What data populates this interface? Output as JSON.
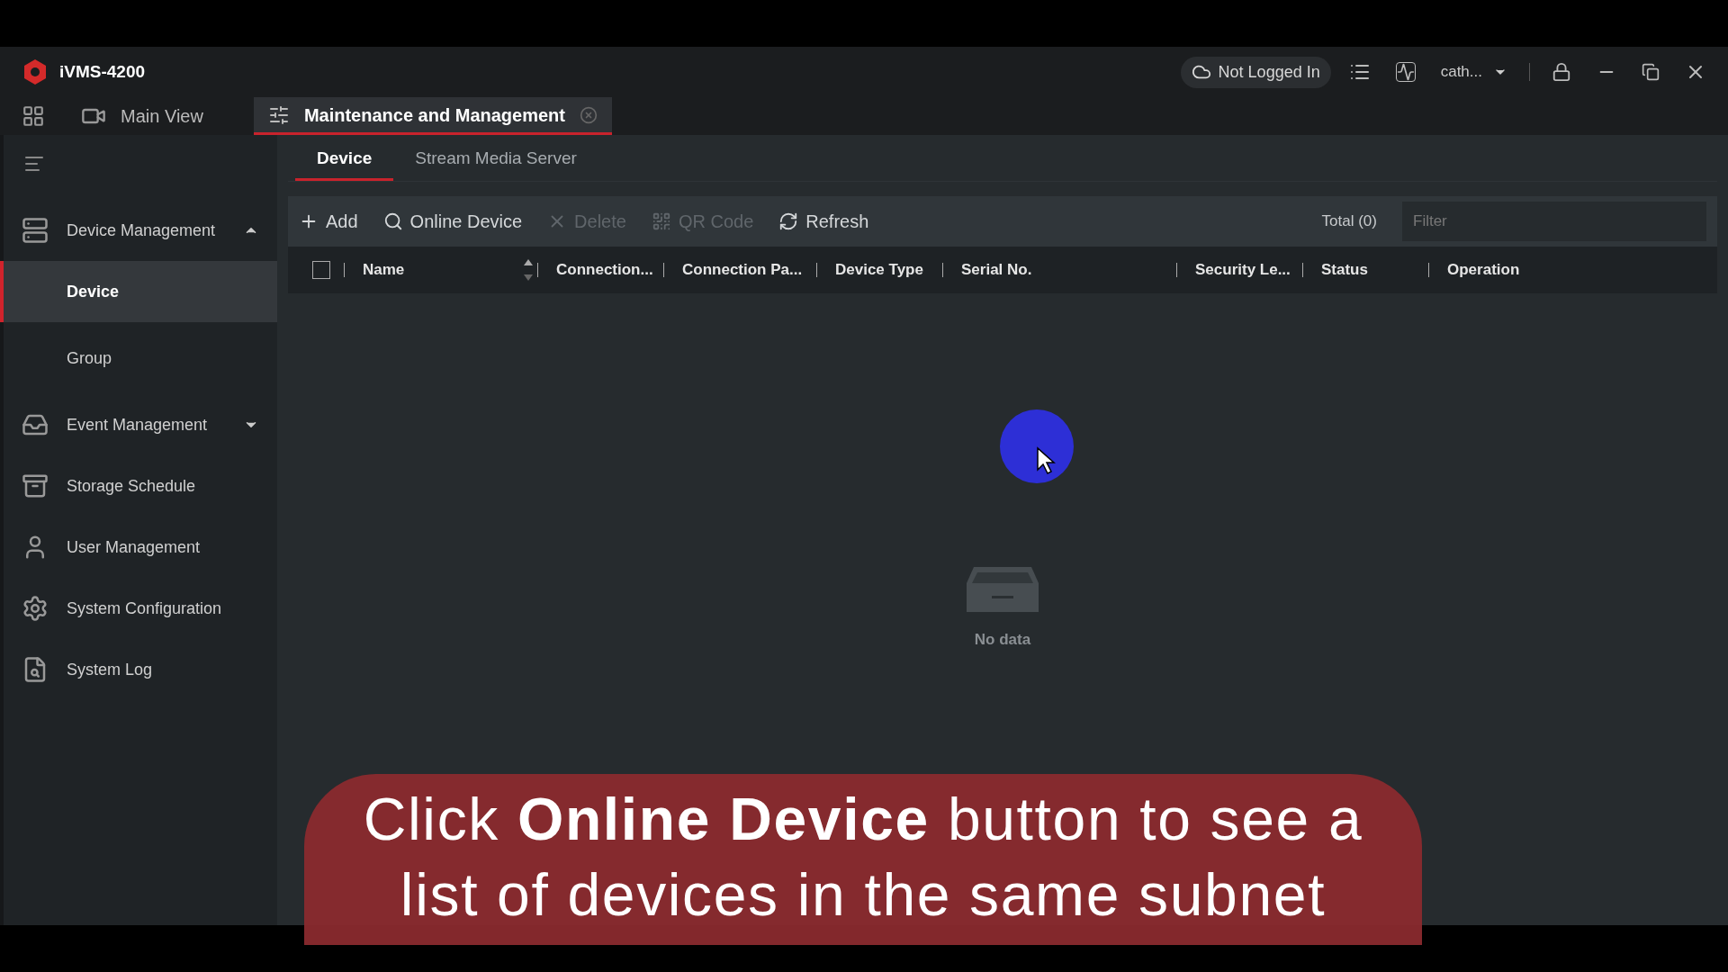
{
  "app": {
    "title": "iVMS-4200",
    "cloud_status": "Not Logged In",
    "user": "cath..."
  },
  "main_tabs": [
    {
      "label": "Main View",
      "selected": false,
      "closable": false
    },
    {
      "label": "Maintenance and Management",
      "selected": true,
      "closable": true
    }
  ],
  "sidebar": {
    "items": [
      {
        "label": "Device Management",
        "expanded": true,
        "children": [
          {
            "label": "Device",
            "selected": true
          },
          {
            "label": "Group",
            "selected": false
          }
        ]
      },
      {
        "label": "Event Management",
        "expanded": false
      },
      {
        "label": "Storage Schedule"
      },
      {
        "label": "User Management"
      },
      {
        "label": "System Configuration"
      },
      {
        "label": "System Log"
      }
    ]
  },
  "sub_tabs": [
    {
      "label": "Device",
      "selected": true
    },
    {
      "label": "Stream Media Server",
      "selected": false
    }
  ],
  "toolbar": [
    {
      "label": "Add",
      "disabled": false
    },
    {
      "label": "Online Device",
      "disabled": false
    },
    {
      "label": "Delete",
      "disabled": true
    },
    {
      "label": "QR Code",
      "disabled": true
    },
    {
      "label": "Refresh",
      "disabled": false
    }
  ],
  "total": "Total (0)",
  "filter": {
    "placeholder": "Filter"
  },
  "table": {
    "select_all_checked": false,
    "columns": [
      "Name",
      "Connection...",
      "Connection Pa...",
      "Device Type",
      "Serial No.",
      "Security Le...",
      "Status",
      "Operation"
    ],
    "empty_text": "No data"
  },
  "caption": {
    "lines": [
      "Click **Online Device** button to see a",
      "list of devices in the same subnet"
    ]
  }
}
